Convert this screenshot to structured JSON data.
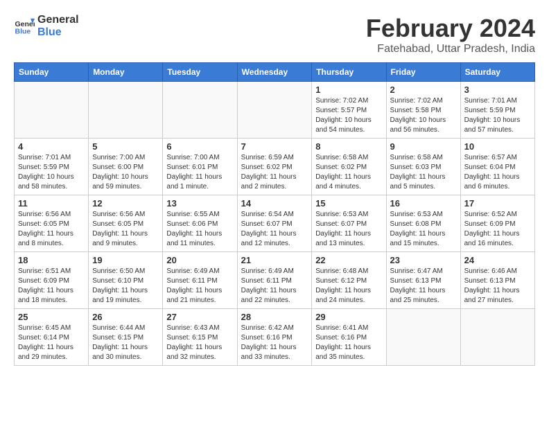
{
  "header": {
    "logo_general": "General",
    "logo_blue": "Blue",
    "month_title": "February 2024",
    "location": "Fatehabad, Uttar Pradesh, India"
  },
  "weekdays": [
    "Sunday",
    "Monday",
    "Tuesday",
    "Wednesday",
    "Thursday",
    "Friday",
    "Saturday"
  ],
  "weeks": [
    [
      {
        "day": "",
        "info": ""
      },
      {
        "day": "",
        "info": ""
      },
      {
        "day": "",
        "info": ""
      },
      {
        "day": "",
        "info": ""
      },
      {
        "day": "1",
        "info": "Sunrise: 7:02 AM\nSunset: 5:57 PM\nDaylight: 10 hours and 54 minutes."
      },
      {
        "day": "2",
        "info": "Sunrise: 7:02 AM\nSunset: 5:58 PM\nDaylight: 10 hours and 56 minutes."
      },
      {
        "day": "3",
        "info": "Sunrise: 7:01 AM\nSunset: 5:59 PM\nDaylight: 10 hours and 57 minutes."
      }
    ],
    [
      {
        "day": "4",
        "info": "Sunrise: 7:01 AM\nSunset: 5:59 PM\nDaylight: 10 hours and 58 minutes."
      },
      {
        "day": "5",
        "info": "Sunrise: 7:00 AM\nSunset: 6:00 PM\nDaylight: 10 hours and 59 minutes."
      },
      {
        "day": "6",
        "info": "Sunrise: 7:00 AM\nSunset: 6:01 PM\nDaylight: 11 hours and 1 minute."
      },
      {
        "day": "7",
        "info": "Sunrise: 6:59 AM\nSunset: 6:02 PM\nDaylight: 11 hours and 2 minutes."
      },
      {
        "day": "8",
        "info": "Sunrise: 6:58 AM\nSunset: 6:02 PM\nDaylight: 11 hours and 4 minutes."
      },
      {
        "day": "9",
        "info": "Sunrise: 6:58 AM\nSunset: 6:03 PM\nDaylight: 11 hours and 5 minutes."
      },
      {
        "day": "10",
        "info": "Sunrise: 6:57 AM\nSunset: 6:04 PM\nDaylight: 11 hours and 6 minutes."
      }
    ],
    [
      {
        "day": "11",
        "info": "Sunrise: 6:56 AM\nSunset: 6:05 PM\nDaylight: 11 hours and 8 minutes."
      },
      {
        "day": "12",
        "info": "Sunrise: 6:56 AM\nSunset: 6:05 PM\nDaylight: 11 hours and 9 minutes."
      },
      {
        "day": "13",
        "info": "Sunrise: 6:55 AM\nSunset: 6:06 PM\nDaylight: 11 hours and 11 minutes."
      },
      {
        "day": "14",
        "info": "Sunrise: 6:54 AM\nSunset: 6:07 PM\nDaylight: 11 hours and 12 minutes."
      },
      {
        "day": "15",
        "info": "Sunrise: 6:53 AM\nSunset: 6:07 PM\nDaylight: 11 hours and 13 minutes."
      },
      {
        "day": "16",
        "info": "Sunrise: 6:53 AM\nSunset: 6:08 PM\nDaylight: 11 hours and 15 minutes."
      },
      {
        "day": "17",
        "info": "Sunrise: 6:52 AM\nSunset: 6:09 PM\nDaylight: 11 hours and 16 minutes."
      }
    ],
    [
      {
        "day": "18",
        "info": "Sunrise: 6:51 AM\nSunset: 6:09 PM\nDaylight: 11 hours and 18 minutes."
      },
      {
        "day": "19",
        "info": "Sunrise: 6:50 AM\nSunset: 6:10 PM\nDaylight: 11 hours and 19 minutes."
      },
      {
        "day": "20",
        "info": "Sunrise: 6:49 AM\nSunset: 6:11 PM\nDaylight: 11 hours and 21 minutes."
      },
      {
        "day": "21",
        "info": "Sunrise: 6:49 AM\nSunset: 6:11 PM\nDaylight: 11 hours and 22 minutes."
      },
      {
        "day": "22",
        "info": "Sunrise: 6:48 AM\nSunset: 6:12 PM\nDaylight: 11 hours and 24 minutes."
      },
      {
        "day": "23",
        "info": "Sunrise: 6:47 AM\nSunset: 6:13 PM\nDaylight: 11 hours and 25 minutes."
      },
      {
        "day": "24",
        "info": "Sunrise: 6:46 AM\nSunset: 6:13 PM\nDaylight: 11 hours and 27 minutes."
      }
    ],
    [
      {
        "day": "25",
        "info": "Sunrise: 6:45 AM\nSunset: 6:14 PM\nDaylight: 11 hours and 29 minutes."
      },
      {
        "day": "26",
        "info": "Sunrise: 6:44 AM\nSunset: 6:15 PM\nDaylight: 11 hours and 30 minutes."
      },
      {
        "day": "27",
        "info": "Sunrise: 6:43 AM\nSunset: 6:15 PM\nDaylight: 11 hours and 32 minutes."
      },
      {
        "day": "28",
        "info": "Sunrise: 6:42 AM\nSunset: 6:16 PM\nDaylight: 11 hours and 33 minutes."
      },
      {
        "day": "29",
        "info": "Sunrise: 6:41 AM\nSunset: 6:16 PM\nDaylight: 11 hours and 35 minutes."
      },
      {
        "day": "",
        "info": ""
      },
      {
        "day": "",
        "info": ""
      }
    ]
  ]
}
